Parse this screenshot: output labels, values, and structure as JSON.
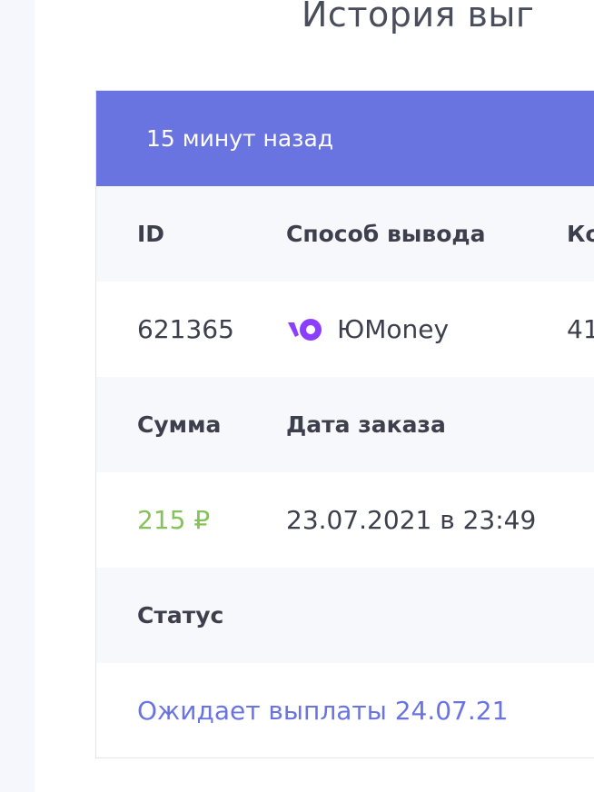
{
  "page": {
    "title": "История выг"
  },
  "order": {
    "time_ago": "15 минут назад",
    "labels": {
      "id": "ID",
      "method": "Способ вывода",
      "third_col_partial": "Ко",
      "amount": "Сумма",
      "date": "Дата заказа",
      "status": "Статус"
    },
    "values": {
      "id": "621365",
      "method_name": "ЮMoney",
      "method_icon": "yoomoney-icon",
      "third_col_partial": "41",
      "amount": "215 ₽",
      "date": "23.07.2021 в 23:49",
      "status": "Ожидает выплаты 24.07.21"
    }
  },
  "colors": {
    "header_bg": "#6a74e0",
    "amount": "#86c25a",
    "status": "#6a74e0",
    "logo": "#8b3ffd"
  }
}
